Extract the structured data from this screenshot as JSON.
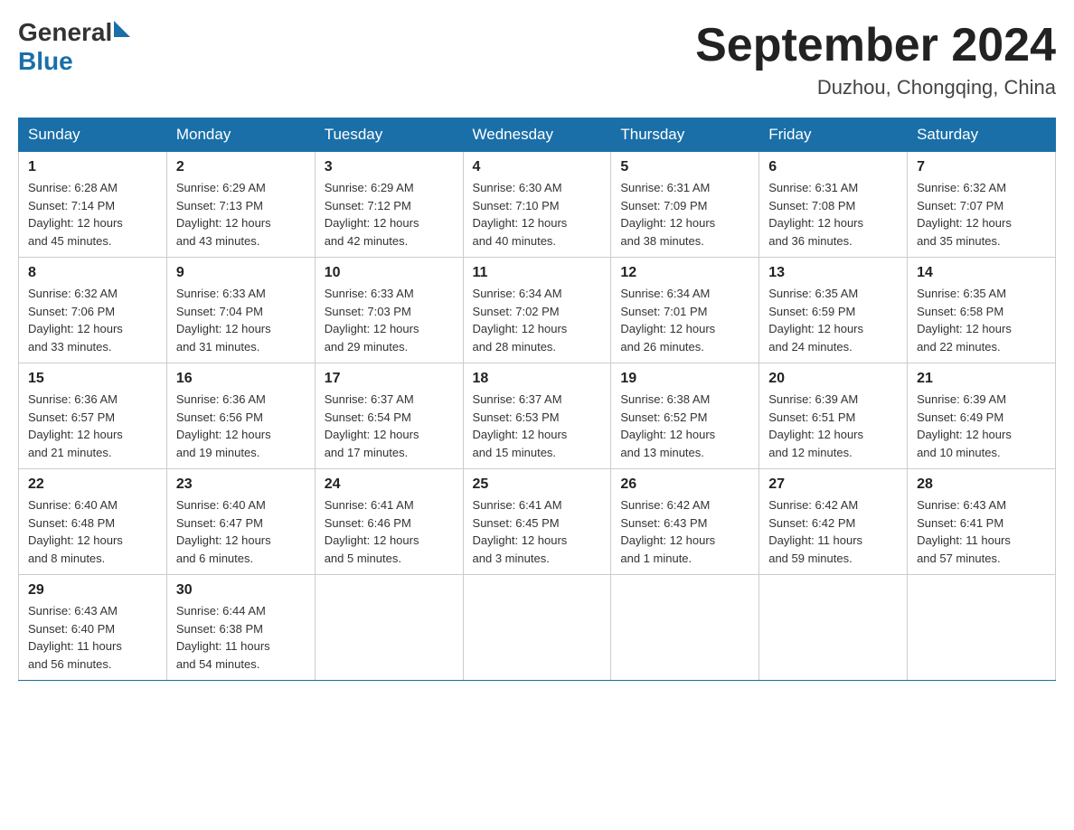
{
  "header": {
    "logo": {
      "text_general": "General",
      "text_blue": "Blue",
      "triangle": true
    },
    "title": "September 2024",
    "subtitle": "Duzhou, Chongqing, China"
  },
  "days_of_week": [
    "Sunday",
    "Monday",
    "Tuesday",
    "Wednesday",
    "Thursday",
    "Friday",
    "Saturday"
  ],
  "weeks": [
    [
      {
        "day": "1",
        "sunrise": "6:28 AM",
        "sunset": "7:14 PM",
        "daylight": "12 hours and 45 minutes."
      },
      {
        "day": "2",
        "sunrise": "6:29 AM",
        "sunset": "7:13 PM",
        "daylight": "12 hours and 43 minutes."
      },
      {
        "day": "3",
        "sunrise": "6:29 AM",
        "sunset": "7:12 PM",
        "daylight": "12 hours and 42 minutes."
      },
      {
        "day": "4",
        "sunrise": "6:30 AM",
        "sunset": "7:10 PM",
        "daylight": "12 hours and 40 minutes."
      },
      {
        "day": "5",
        "sunrise": "6:31 AM",
        "sunset": "7:09 PM",
        "daylight": "12 hours and 38 minutes."
      },
      {
        "day": "6",
        "sunrise": "6:31 AM",
        "sunset": "7:08 PM",
        "daylight": "12 hours and 36 minutes."
      },
      {
        "day": "7",
        "sunrise": "6:32 AM",
        "sunset": "7:07 PM",
        "daylight": "12 hours and 35 minutes."
      }
    ],
    [
      {
        "day": "8",
        "sunrise": "6:32 AM",
        "sunset": "7:06 PM",
        "daylight": "12 hours and 33 minutes."
      },
      {
        "day": "9",
        "sunrise": "6:33 AM",
        "sunset": "7:04 PM",
        "daylight": "12 hours and 31 minutes."
      },
      {
        "day": "10",
        "sunrise": "6:33 AM",
        "sunset": "7:03 PM",
        "daylight": "12 hours and 29 minutes."
      },
      {
        "day": "11",
        "sunrise": "6:34 AM",
        "sunset": "7:02 PM",
        "daylight": "12 hours and 28 minutes."
      },
      {
        "day": "12",
        "sunrise": "6:34 AM",
        "sunset": "7:01 PM",
        "daylight": "12 hours and 26 minutes."
      },
      {
        "day": "13",
        "sunrise": "6:35 AM",
        "sunset": "6:59 PM",
        "daylight": "12 hours and 24 minutes."
      },
      {
        "day": "14",
        "sunrise": "6:35 AM",
        "sunset": "6:58 PM",
        "daylight": "12 hours and 22 minutes."
      }
    ],
    [
      {
        "day": "15",
        "sunrise": "6:36 AM",
        "sunset": "6:57 PM",
        "daylight": "12 hours and 21 minutes."
      },
      {
        "day": "16",
        "sunrise": "6:36 AM",
        "sunset": "6:56 PM",
        "daylight": "12 hours and 19 minutes."
      },
      {
        "day": "17",
        "sunrise": "6:37 AM",
        "sunset": "6:54 PM",
        "daylight": "12 hours and 17 minutes."
      },
      {
        "day": "18",
        "sunrise": "6:37 AM",
        "sunset": "6:53 PM",
        "daylight": "12 hours and 15 minutes."
      },
      {
        "day": "19",
        "sunrise": "6:38 AM",
        "sunset": "6:52 PM",
        "daylight": "12 hours and 13 minutes."
      },
      {
        "day": "20",
        "sunrise": "6:39 AM",
        "sunset": "6:51 PM",
        "daylight": "12 hours and 12 minutes."
      },
      {
        "day": "21",
        "sunrise": "6:39 AM",
        "sunset": "6:49 PM",
        "daylight": "12 hours and 10 minutes."
      }
    ],
    [
      {
        "day": "22",
        "sunrise": "6:40 AM",
        "sunset": "6:48 PM",
        "daylight": "12 hours and 8 minutes."
      },
      {
        "day": "23",
        "sunrise": "6:40 AM",
        "sunset": "6:47 PM",
        "daylight": "12 hours and 6 minutes."
      },
      {
        "day": "24",
        "sunrise": "6:41 AM",
        "sunset": "6:46 PM",
        "daylight": "12 hours and 5 minutes."
      },
      {
        "day": "25",
        "sunrise": "6:41 AM",
        "sunset": "6:45 PM",
        "daylight": "12 hours and 3 minutes."
      },
      {
        "day": "26",
        "sunrise": "6:42 AM",
        "sunset": "6:43 PM",
        "daylight": "12 hours and 1 minute."
      },
      {
        "day": "27",
        "sunrise": "6:42 AM",
        "sunset": "6:42 PM",
        "daylight": "11 hours and 59 minutes."
      },
      {
        "day": "28",
        "sunrise": "6:43 AM",
        "sunset": "6:41 PM",
        "daylight": "11 hours and 57 minutes."
      }
    ],
    [
      {
        "day": "29",
        "sunrise": "6:43 AM",
        "sunset": "6:40 PM",
        "daylight": "11 hours and 56 minutes."
      },
      {
        "day": "30",
        "sunrise": "6:44 AM",
        "sunset": "6:38 PM",
        "daylight": "11 hours and 54 minutes."
      },
      null,
      null,
      null,
      null,
      null
    ]
  ],
  "labels": {
    "sunrise": "Sunrise:",
    "sunset": "Sunset:",
    "daylight": "Daylight:"
  }
}
